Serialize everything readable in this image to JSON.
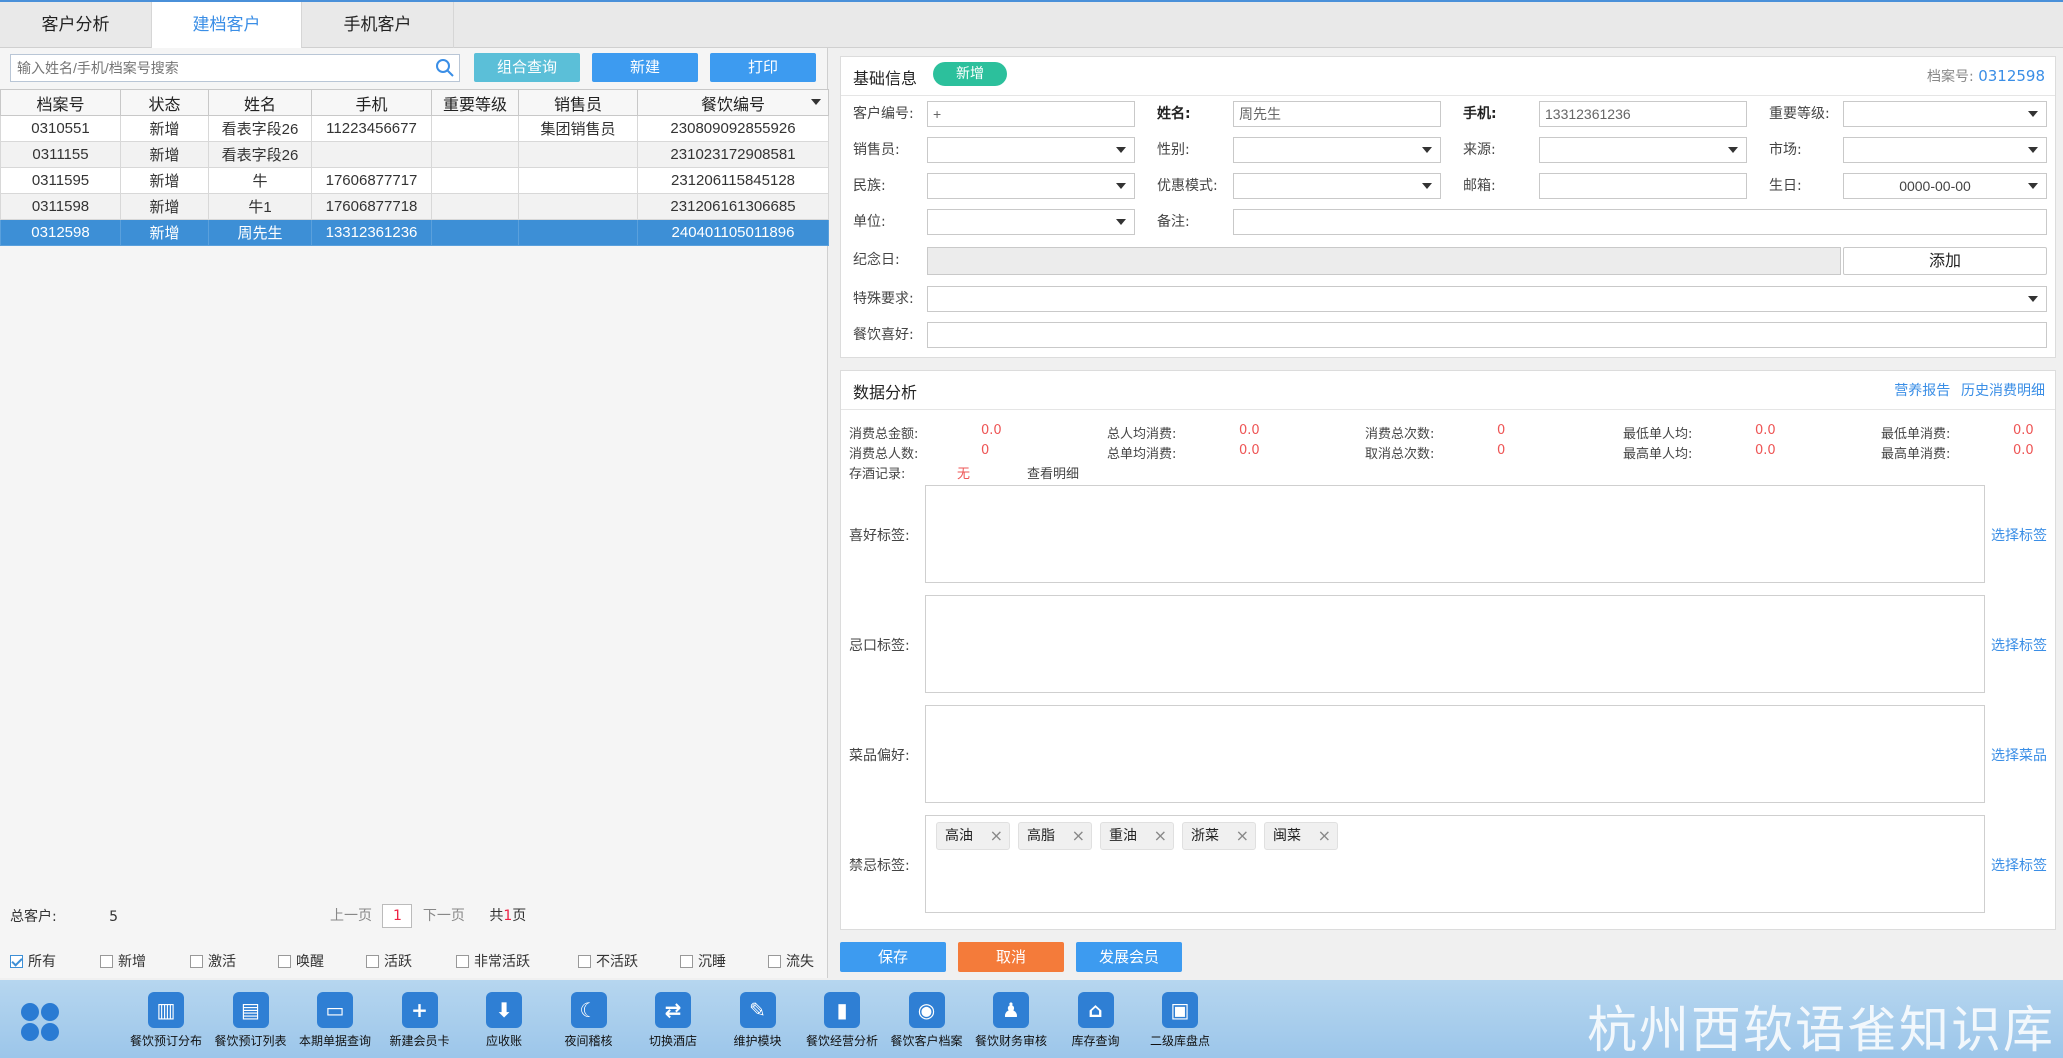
{
  "tabs": [
    "客户分析",
    "建档客户",
    "手机客户"
  ],
  "search": {
    "placeholder": "输入姓名/手机/档案号搜索"
  },
  "toolbar": {
    "combo_query": "组合查询",
    "new": "新建",
    "print": "打印"
  },
  "table": {
    "headers": [
      "档案号",
      "状态",
      "姓名",
      "手机",
      "重要等级",
      "销售员",
      "餐饮编号"
    ],
    "rows": [
      [
        "0310551",
        "新增",
        "看表字段26",
        "11223456677",
        "",
        "集团销售员",
        "230809092855926"
      ],
      [
        "0311155",
        "新增",
        "看表字段26",
        "",
        "",
        "",
        "231023172908581"
      ],
      [
        "0311595",
        "新增",
        "牛",
        "17606877717",
        "",
        "",
        "231206115845128"
      ],
      [
        "0311598",
        "新增",
        "牛1",
        "17606877718",
        "",
        "",
        "231206161306685"
      ],
      [
        "0312598",
        "新增",
        "周先生",
        "13312361236",
        "",
        "",
        "240401105011896"
      ]
    ],
    "selected_index": 4
  },
  "summary": {
    "total_label": "总客户:",
    "total_value": "5"
  },
  "pager": {
    "prev": "上一页",
    "page": "1",
    "next": "下一页",
    "total_prefix": "共",
    "total_pages": "1",
    "total_suffix": "页"
  },
  "filters": [
    {
      "label": "所有",
      "checked": true
    },
    {
      "label": "新增",
      "checked": false
    },
    {
      "label": "激活",
      "checked": false
    },
    {
      "label": "唤醒",
      "checked": false
    },
    {
      "label": "活跃",
      "checked": false
    },
    {
      "label": "非常活跃",
      "checked": false
    },
    {
      "label": "不活跃",
      "checked": false
    },
    {
      "label": "沉睡",
      "checked": false
    },
    {
      "label": "流失",
      "checked": false
    }
  ],
  "basic": {
    "title": "基础信息",
    "status_pill": "新增",
    "dossier_label": "档案号:",
    "dossier_value": "0312598",
    "fields": {
      "customer_no": {
        "label": "客户编号:",
        "value": "+"
      },
      "name": {
        "label": "姓名:",
        "value": "周先生"
      },
      "phone": {
        "label": "手机:",
        "value": "13312361236"
      },
      "importance": {
        "label": "重要等级:",
        "value": ""
      },
      "salesman": {
        "label": "销售员:",
        "value": ""
      },
      "gender": {
        "label": "性别:",
        "value": ""
      },
      "source": {
        "label": "来源:",
        "value": ""
      },
      "market": {
        "label": "市场:",
        "value": ""
      },
      "ethnicity": {
        "label": "民族:",
        "value": ""
      },
      "discount_mode": {
        "label": "优惠模式:",
        "value": ""
      },
      "email": {
        "label": "邮箱:",
        "value": ""
      },
      "birthday": {
        "label": "生日:",
        "value": "0000-00-00"
      },
      "company": {
        "label": "单位:",
        "value": ""
      },
      "remark": {
        "label": "备注:",
        "value": ""
      },
      "anniversary": {
        "label": "纪念日:",
        "value": ""
      },
      "special": {
        "label": "特殊要求:",
        "value": ""
      },
      "dining_pref": {
        "label": "餐饮喜好:",
        "value": ""
      }
    },
    "add_button": "添加"
  },
  "analysis": {
    "title": "数据分析",
    "links": {
      "nutrition": "营养报告",
      "history": "历史消费明细"
    },
    "stats": [
      {
        "label": "消费总金额:",
        "value": "0.0"
      },
      {
        "label": "总人均消费:",
        "value": "0.0"
      },
      {
        "label": "消费总次数:",
        "value": "0"
      },
      {
        "label": "最低单人均:",
        "value": "0.0"
      },
      {
        "label": "最低单消费:",
        "value": "0.0"
      },
      {
        "label": "消费总人数:",
        "value": "0"
      },
      {
        "label": "总单均消费:",
        "value": "0.0"
      },
      {
        "label": "取消总次数:",
        "value": "0"
      },
      {
        "label": "最高单人均:",
        "value": "0.0"
      },
      {
        "label": "最高单消费:",
        "value": "0.0"
      }
    ],
    "wine": {
      "label": "存酒记录:",
      "value": "无",
      "link": "查看明细"
    },
    "tag_rows": [
      {
        "label": "喜好标签:",
        "link": "选择标签"
      },
      {
        "label": "忌口标签:",
        "link": "选择标签"
      },
      {
        "label": "菜品偏好:",
        "link": "选择菜品"
      },
      {
        "label": "禁忌标签:",
        "link": "选择标签"
      }
    ],
    "forbidden_chips": [
      "高油",
      "高脂",
      "重油",
      "浙菜",
      "闽菜"
    ]
  },
  "actions": {
    "save": "保存",
    "cancel": "取消",
    "develop": "发展会员"
  },
  "colors": {
    "primary": "#3d9bf0",
    "orange": "#f47b3a",
    "teal": "#2cc09c",
    "selected_row": "#3d8fd6"
  },
  "taskbar": [
    {
      "label": "餐饮预订分布",
      "icon": "bar-chart-icon"
    },
    {
      "label": "餐饮预订列表",
      "icon": "clipboard-icon"
    },
    {
      "label": "本期单据查询",
      "icon": "message-icon"
    },
    {
      "label": "新建会员卡",
      "icon": "plus-circle-icon"
    },
    {
      "label": "应收账",
      "icon": "download-icon"
    },
    {
      "label": "夜间稽核",
      "icon": "moon-icon"
    },
    {
      "label": "切换酒店",
      "icon": "switch-icon"
    },
    {
      "label": "维护模块",
      "icon": "wrench-icon"
    },
    {
      "label": "餐饮经营分析",
      "icon": "chart-icon"
    },
    {
      "label": "餐饮客户档案",
      "icon": "user-circle-icon"
    },
    {
      "label": "餐饮财务审核",
      "icon": "user-icon"
    },
    {
      "label": "库存查询",
      "icon": "home-icon"
    },
    {
      "label": "二级库盘点",
      "icon": "inventory-icon"
    }
  ],
  "watermark": "杭州西软语雀知识库"
}
